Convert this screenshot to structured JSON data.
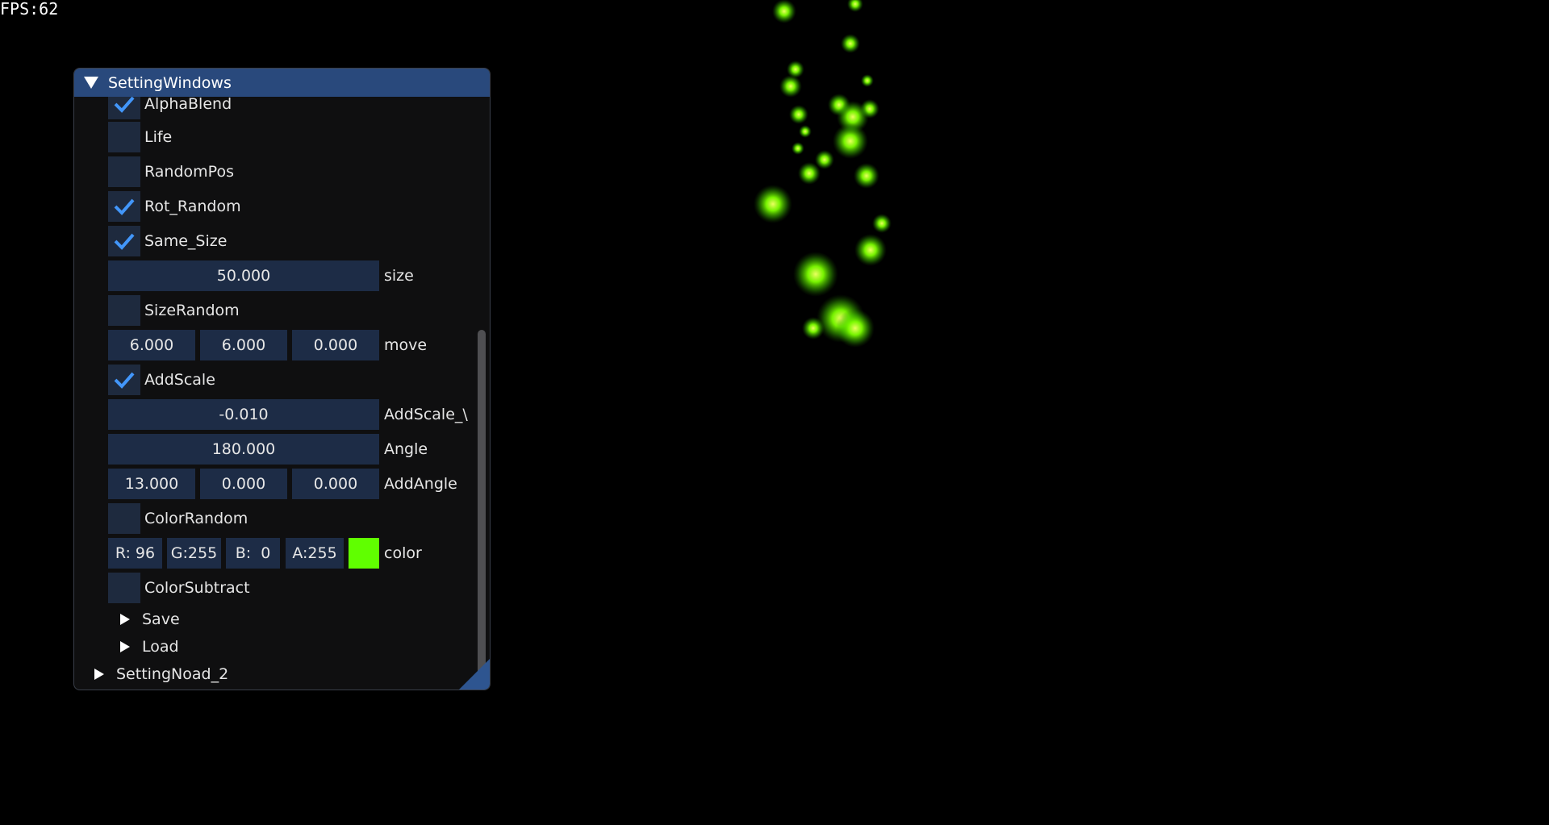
{
  "fps": {
    "label": "FPS:62"
  },
  "window": {
    "title": "SettingWindows",
    "rows": [
      {
        "type": "checkbox",
        "label": "AlphaBlend",
        "checked": true
      },
      {
        "type": "checkbox",
        "label": "Life",
        "checked": false
      },
      {
        "type": "checkbox",
        "label": "RandomPos",
        "checked": false
      },
      {
        "type": "checkbox",
        "label": "Rot_Random",
        "checked": true
      },
      {
        "type": "checkbox",
        "label": "Same_Size",
        "checked": true
      },
      {
        "type": "float1",
        "values": [
          "50.000"
        ],
        "label": "size"
      },
      {
        "type": "checkbox",
        "label": "SizeRandom",
        "checked": false
      },
      {
        "type": "float3",
        "values": [
          "6.000",
          "6.000",
          "0.000"
        ],
        "label": "move"
      },
      {
        "type": "checkbox",
        "label": "AddScale",
        "checked": true
      },
      {
        "type": "float1",
        "values": [
          "-0.010"
        ],
        "label": "AddScale_\\"
      },
      {
        "type": "float1",
        "values": [
          "180.000"
        ],
        "label": "Angle"
      },
      {
        "type": "float3",
        "values": [
          "13.000",
          "0.000",
          "0.000"
        ],
        "label": "AddAngle"
      },
      {
        "type": "checkbox",
        "label": "ColorRandom",
        "checked": false
      },
      {
        "type": "color",
        "values": [
          "R: 96",
          "G:255",
          "B:  0",
          "A:255"
        ],
        "swatch": "#60ff00",
        "label": "color"
      },
      {
        "type": "checkbox",
        "label": "ColorSubtract",
        "checked": false
      }
    ],
    "tree": [
      {
        "label": "Save",
        "expanded": false
      },
      {
        "label": "Load",
        "expanded": false
      }
    ],
    "bottom_node": {
      "label": "SettingNoad_2",
      "expanded": false
    }
  },
  "colors": {
    "title_bar": "#29497c",
    "checkmark": "#4296fa",
    "particle": "#7dff00"
  }
}
